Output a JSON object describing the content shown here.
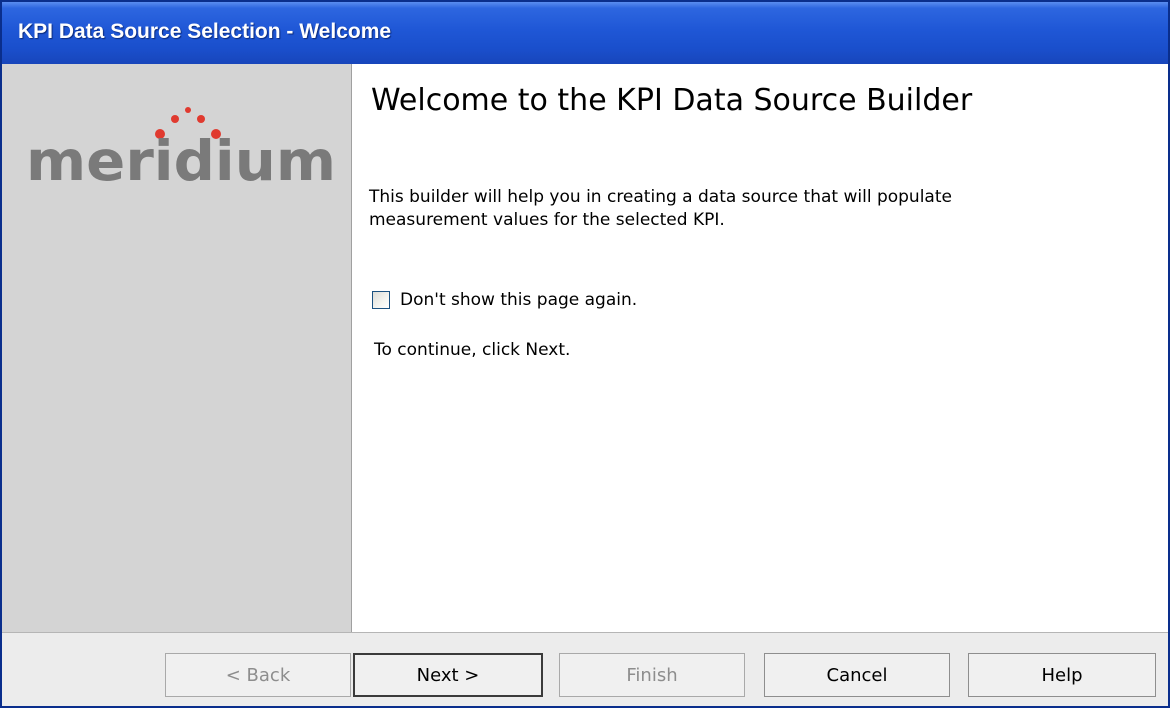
{
  "window": {
    "title": "KPI Data Source Selection - Welcome"
  },
  "sidebar": {
    "logo_text": "meridium",
    "logo_color": "#7a7a7a",
    "logo_dot_color": "#e03a2f"
  },
  "content": {
    "heading": "Welcome to the KPI Data Source Builder",
    "description": "This builder will help you in creating a data source that will populate measurement values for the selected KPI.",
    "checkbox_label": "Don't show this page again.",
    "checkbox_checked": false,
    "continue_text": "To continue, click Next."
  },
  "buttons": {
    "back": "< Back",
    "next": "Next >",
    "finish": "Finish",
    "cancel": "Cancel",
    "help": "Help"
  }
}
